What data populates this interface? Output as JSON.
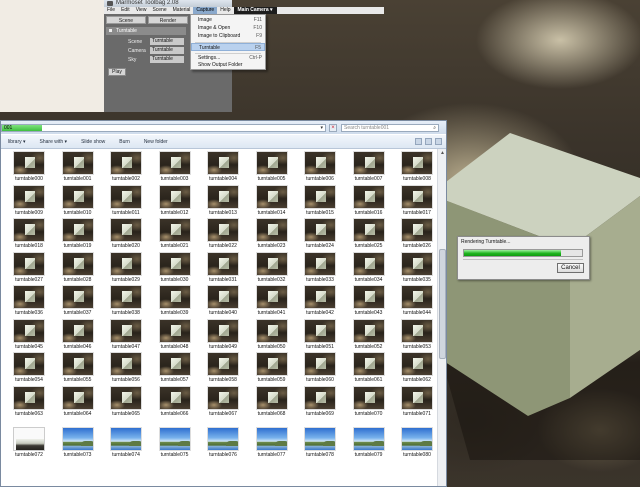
{
  "marmoset": {
    "title": "Marmoset Toolbag 2.08",
    "menu": [
      "File",
      "Edit",
      "View",
      "Scene",
      "Material",
      "Capture",
      "Help"
    ],
    "camera_menu": "Main Camera ▾",
    "tabs": [
      "Scene",
      "Render"
    ],
    "turntable_section": "Turntable",
    "rows": [
      {
        "label": "Scene",
        "value": "Turntable"
      },
      {
        "label": "Camera",
        "value": "Turntable"
      },
      {
        "label": "Sky",
        "value": "Turntable"
      }
    ],
    "play_label": "Play"
  },
  "capture_menu": {
    "items": [
      {
        "label": "Image",
        "shortcut": "F11"
      },
      {
        "label": "Image & Open",
        "shortcut": "F10"
      },
      {
        "label": "Image to Clipboard",
        "shortcut": "F9"
      },
      {
        "label": "Turntable",
        "shortcut": "F5"
      },
      {
        "label": "Settings...",
        "shortcut": "Ctrl-P"
      },
      {
        "label": "Show Output Folder",
        "shortcut": ""
      }
    ],
    "highlighted": "Turntable"
  },
  "explorer": {
    "path_text": "001",
    "search_placeholder": "Search turntable001",
    "toolbar": [
      "library",
      "Share with",
      "Slide show",
      "Burn",
      "New folder"
    ],
    "files": [
      "turntable000",
      "turntable001",
      "turntable002",
      "turntable003",
      "turntable004",
      "turntable005",
      "turntable006",
      "turntable007",
      "turntable008",
      "turntable009",
      "turntable010",
      "turntable011",
      "turntable012",
      "turntable013",
      "turntable014",
      "turntable015",
      "turntable016",
      "turntable017",
      "turntable018",
      "turntable019",
      "turntable020",
      "turntable021",
      "turntable022",
      "turntable023",
      "turntable024",
      "turntable025",
      "turntable026",
      "turntable027",
      "turntable028",
      "turntable029",
      "turntable030",
      "turntable031",
      "turntable032",
      "turntable033",
      "turntable034",
      "turntable035",
      "turntable036",
      "turntable037",
      "turntable038",
      "turntable039",
      "turntable040",
      "turntable041",
      "turntable042",
      "turntable043",
      "turntable044",
      "turntable045",
      "turntable046",
      "turntable047",
      "turntable048",
      "turntable049",
      "turntable050",
      "turntable051",
      "turntable052",
      "turntable053",
      "turntable054",
      "turntable055",
      "turntable056",
      "turntable057",
      "turntable058",
      "turntable059",
      "turntable060",
      "turntable061",
      "turntable062",
      "turntable063",
      "turntable064",
      "turntable065",
      "turntable066",
      "turntable067",
      "turntable068",
      "turntable069",
      "turntable070",
      "turntable071",
      "turntable072",
      "turntable073",
      "turntable074",
      "turntable075",
      "turntable076",
      "turntable077",
      "turntable078",
      "turntable079",
      "turntable080"
    ],
    "rendered_count": 72,
    "partial_index": 72
  },
  "render_dialog": {
    "title": "Rendering Turntable...",
    "progress": 0.82,
    "cancel_label": "Cancel"
  },
  "colors": {
    "progress_green": "#1fb51f",
    "menu_highlight": "#b9d1ee",
    "camera_bg": "#1d1d1d"
  }
}
